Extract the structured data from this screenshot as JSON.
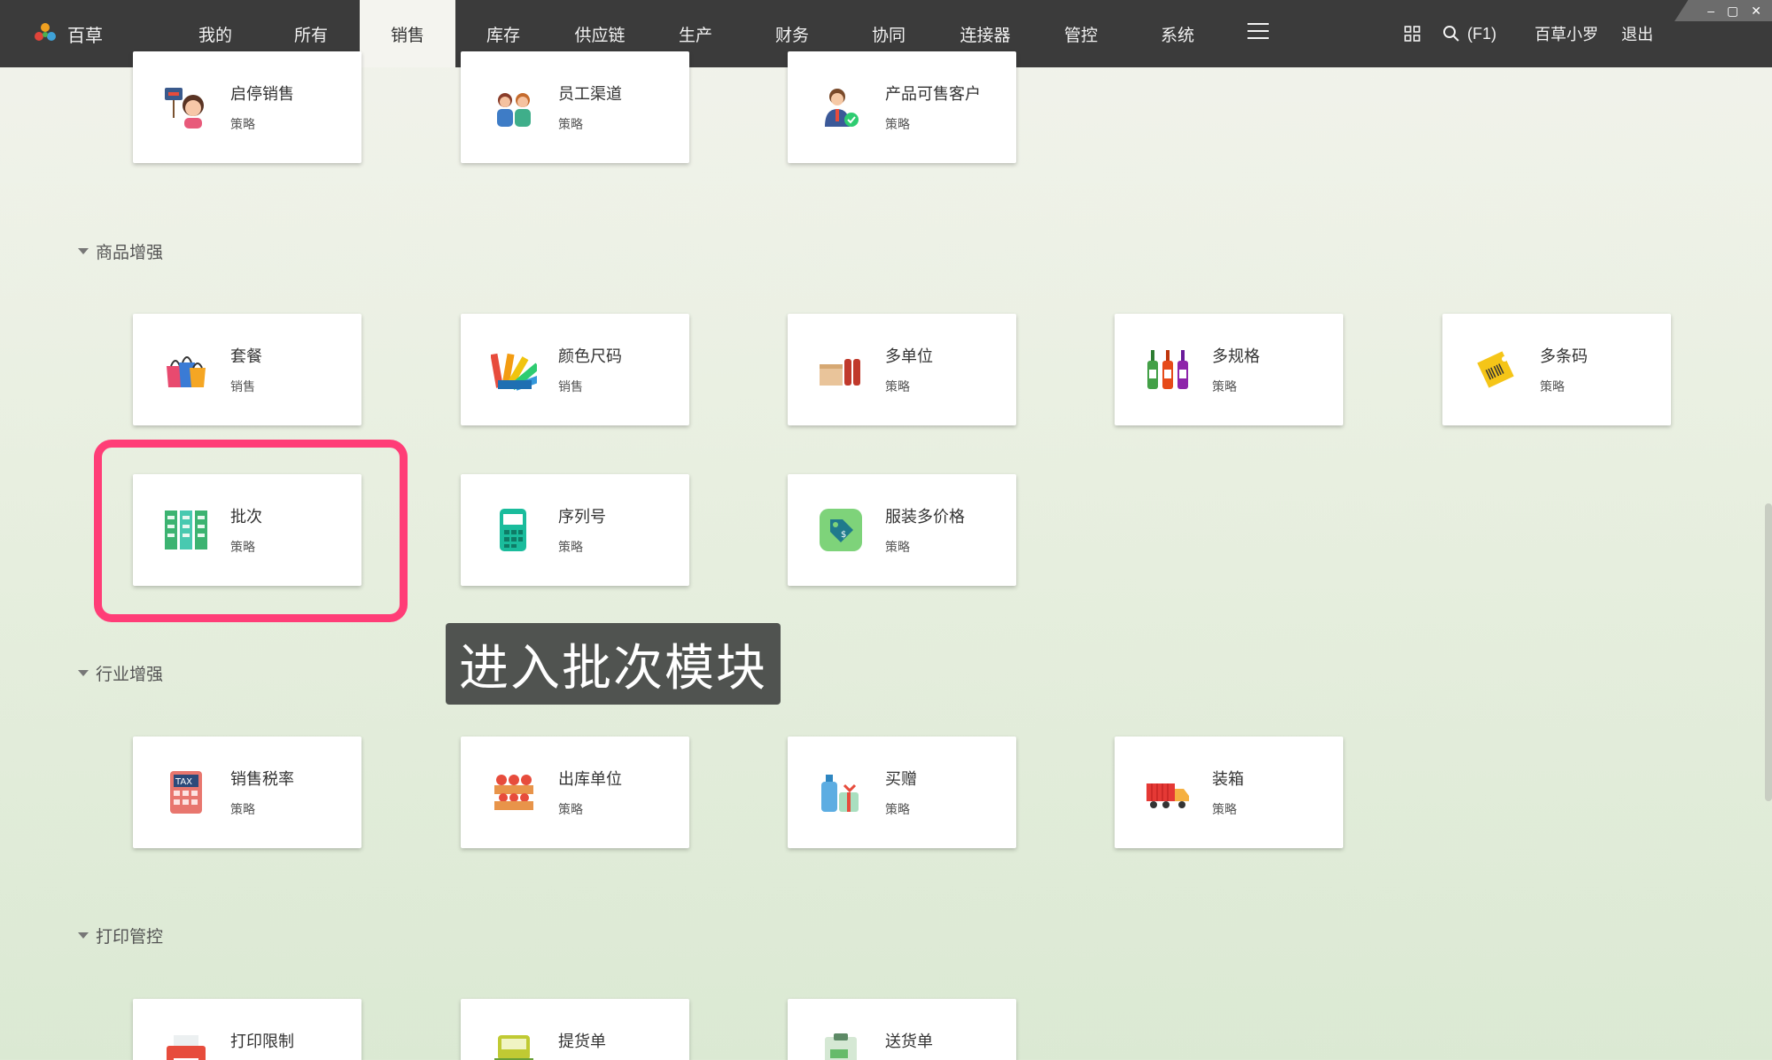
{
  "app": {
    "name": "百草",
    "nav": [
      "我的",
      "所有",
      "销售",
      "库存",
      "供应链",
      "生产",
      "财务",
      "协同",
      "连接器",
      "管控",
      "系统"
    ],
    "active_tab": "销售",
    "search_shortcut": "(F1)",
    "user": "百草小罗",
    "logout": "退出",
    "window_controls": [
      "–",
      "▢",
      "✕"
    ]
  },
  "top_cards": [
    {
      "title": "启停销售",
      "subtitle": "策略",
      "icon": "stop-sale-person-icon"
    },
    {
      "title": "员工渠道",
      "subtitle": "策略",
      "icon": "employees-icon"
    },
    {
      "title": "产品可售客户",
      "subtitle": "策略",
      "icon": "verified-customer-icon"
    }
  ],
  "sections": [
    {
      "title": "商品增强",
      "cards": [
        {
          "title": "套餐",
          "subtitle": "销售",
          "icon": "shopping-bags-icon"
        },
        {
          "title": "颜色尺码",
          "subtitle": "销售",
          "icon": "color-palette-icon"
        },
        {
          "title": "多单位",
          "subtitle": "策略",
          "icon": "boxes-bottles-icon"
        },
        {
          "title": "多规格",
          "subtitle": "策略",
          "icon": "wine-bottles-icon"
        },
        {
          "title": "多条码",
          "subtitle": "策略",
          "icon": "barcode-tag-icon"
        },
        {
          "title": "批次",
          "subtitle": "策略",
          "icon": "batch-binders-icon"
        },
        {
          "title": "序列号",
          "subtitle": "策略",
          "icon": "serial-device-icon"
        },
        {
          "title": "服装多价格",
          "subtitle": "策略",
          "icon": "price-tag-icon"
        }
      ]
    },
    {
      "title": "行业增强",
      "cards": [
        {
          "title": "销售税率",
          "subtitle": "策略",
          "icon": "tax-calculator-icon"
        },
        {
          "title": "出库单位",
          "subtitle": "策略",
          "icon": "fruit-crate-icon"
        },
        {
          "title": "买赠",
          "subtitle": "策略",
          "icon": "gift-bottles-icon"
        },
        {
          "title": "装箱",
          "subtitle": "策略",
          "icon": "truck-icon"
        }
      ]
    },
    {
      "title": "打印管控",
      "cards": [
        {
          "title": "打印限制",
          "subtitle": "",
          "icon": "printer-icon"
        },
        {
          "title": "提货单",
          "subtitle": "",
          "icon": "pickup-truck-icon"
        },
        {
          "title": "送货单",
          "subtitle": "",
          "icon": "delivery-clipboard-icon"
        }
      ]
    }
  ],
  "tooltip": "进入批次模块"
}
